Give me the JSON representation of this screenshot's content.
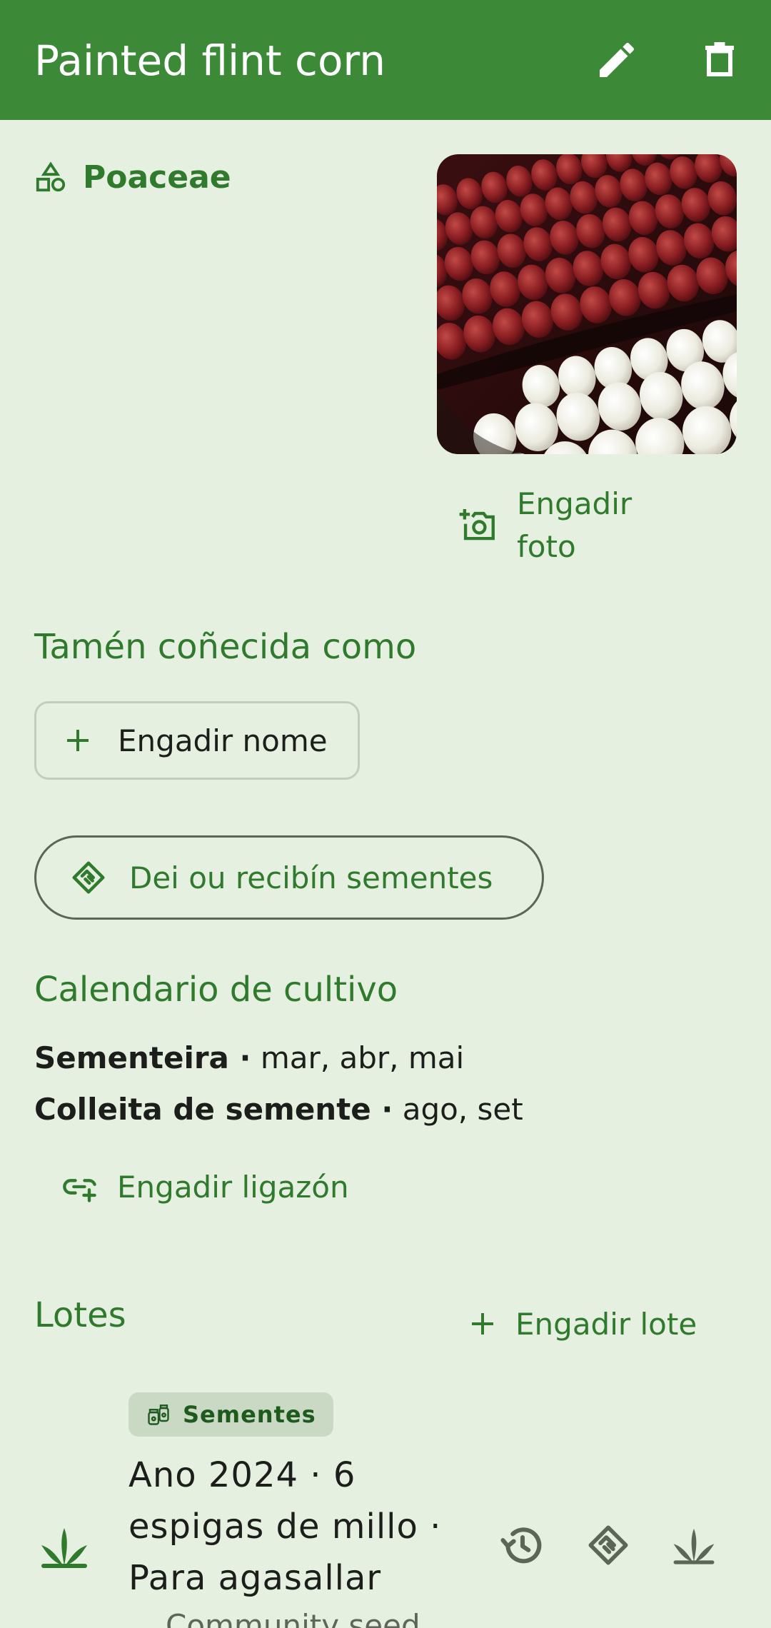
{
  "appbar": {
    "title": "Painted flint corn",
    "edit_icon": "pencil-icon",
    "delete_icon": "trash-icon"
  },
  "family": {
    "icon": "shapes-icon",
    "label": "Poaceae"
  },
  "photo": {
    "add_photo_label": "Engadir foto",
    "icon": "add-camera-icon"
  },
  "aka": {
    "title": "Tamén coñecida como",
    "add_name_label": "Engadir nome"
  },
  "exchange_button": {
    "label": "Dei ou recibín sementes",
    "icon": "handshake-icon"
  },
  "calendar": {
    "title": "Calendario de cultivo",
    "rows": [
      {
        "label": "Sementeira ·",
        "value": "mar, abr, mai"
      },
      {
        "label": "Colleita de semente ·",
        "value": "ago, set"
      }
    ],
    "add_link_label": "Engadir ligazón",
    "add_link_icon": "add-link-icon"
  },
  "lots": {
    "title": "Lotes",
    "add_lot_label": "Engadir lote",
    "items": [
      {
        "badge": "Sementes",
        "badge_icon": "seed-jars-icon",
        "text": "Ano 2024 · 6 espigas de millo · Para agasallar",
        "source": "Community seed",
        "leading_icon": "sprout-icon",
        "actions": [
          "history-icon",
          "handshake-icon",
          "sprout-icon"
        ]
      }
    ]
  },
  "colors": {
    "primary": "#3c8a37",
    "background": "#e6f0e0",
    "accent_text": "#2f7a2d"
  }
}
